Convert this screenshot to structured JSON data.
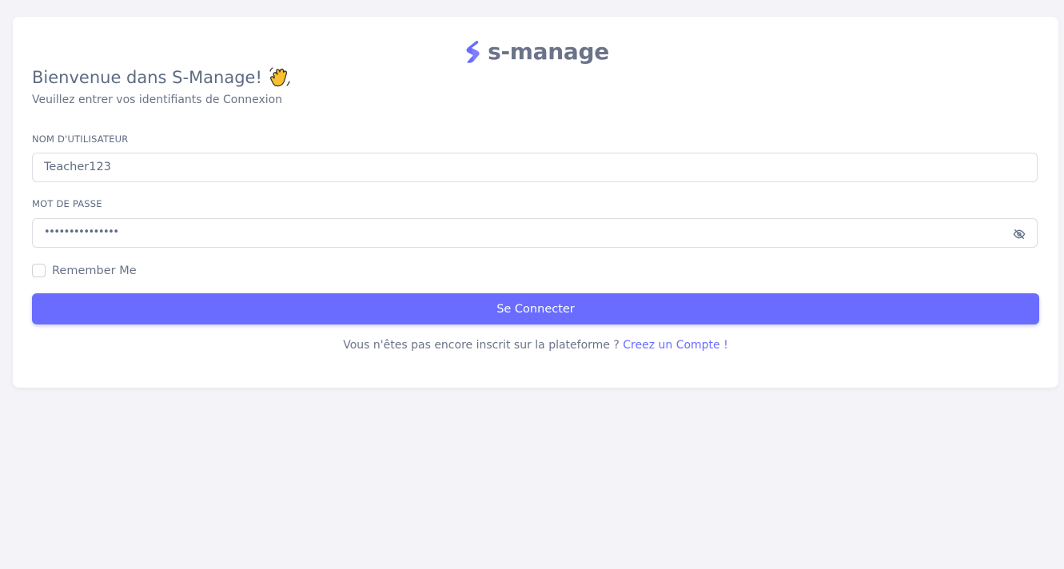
{
  "brand": {
    "name": "s-manage",
    "logo_icon": "s-logo-icon",
    "accent_color": "#696cff"
  },
  "welcome": {
    "title": "Bienvenue dans S-Manage!",
    "emoji_icon": "waving-hand-icon",
    "subtitle": "Veuillez entrer vos identifiants de Connexion"
  },
  "form": {
    "username": {
      "label": "NOM D'UTILISATEUR",
      "value": "Teacher123"
    },
    "password": {
      "label": "MOT DE PASSE",
      "masked_value": "•••••••••••••••",
      "toggle_icon": "eye-off-icon"
    },
    "remember": {
      "label": "Remember Me",
      "checked": false
    },
    "submit_label": "Se Connecter"
  },
  "signup": {
    "prompt": "Vous n'êtes pas encore inscrit sur la plateforme ? ",
    "link_label": "Creez un Compte",
    "suffix": " !"
  }
}
